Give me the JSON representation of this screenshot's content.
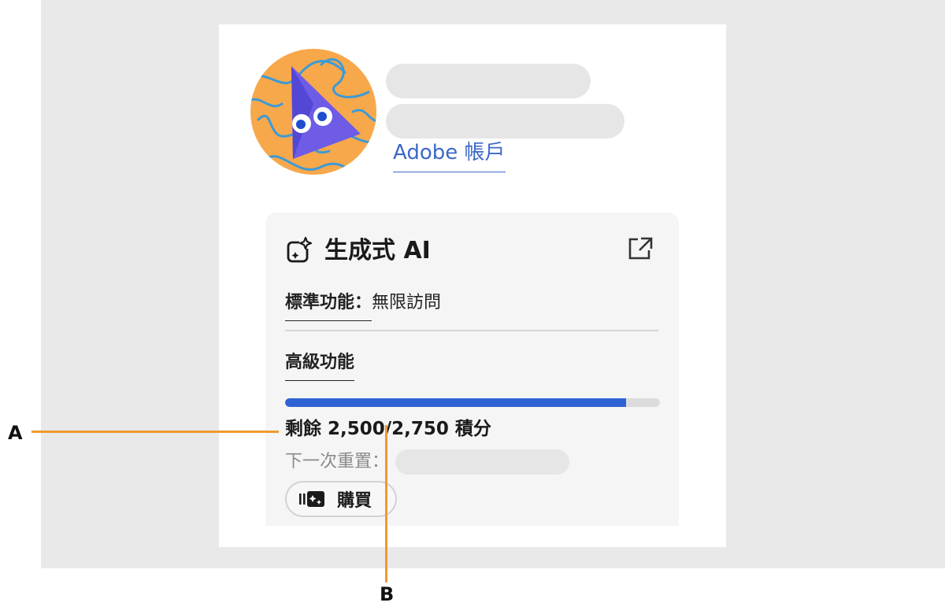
{
  "account": {
    "link_label": "Adobe 帳戶"
  },
  "generative_ai": {
    "title": "生成式 AI",
    "standard_label": "標準功能：",
    "standard_value": "無限訪問",
    "premium_label": "高級功能",
    "credits_used_fraction": 0.909,
    "credits_text": "剩餘 2,500/2,750 積分",
    "next_reset_label": "下一次重置：",
    "buy_label": "購買"
  },
  "callouts": {
    "a": "A",
    "b": "B"
  },
  "colors": {
    "link": "#3c68c8",
    "progress": "#2f63d4",
    "callout": "#ef9a2e",
    "avatar_bg": "#f7a84b",
    "avatar_figure": "#6e5ce6"
  },
  "icons": {
    "ai": "generative-ai-icon",
    "external": "external-link-icon",
    "buy": "credits-icon"
  }
}
